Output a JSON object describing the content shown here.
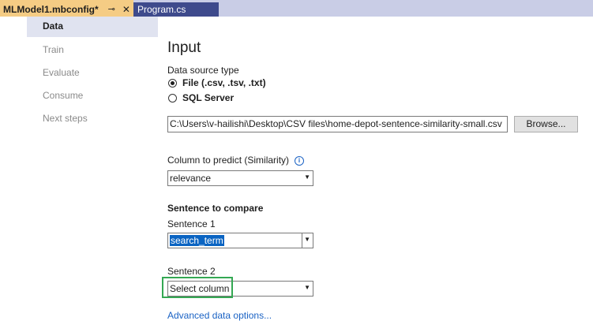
{
  "tabs": [
    {
      "label": "MLModel1.mbconfig*",
      "pin_icon": "pin-icon",
      "close_icon": "close-icon"
    },
    {
      "label": "Program.cs"
    }
  ],
  "steps": [
    "Data",
    "Train",
    "Evaluate",
    "Consume",
    "Next steps"
  ],
  "active_step": "Data",
  "input": {
    "heading": "Input",
    "data_source_label": "Data source type",
    "options": [
      {
        "label": "File (.csv, .tsv, .txt)",
        "checked": true
      },
      {
        "label": "SQL Server",
        "checked": false
      }
    ],
    "file_path": "C:\\Users\\v-hailishi\\Desktop\\CSV files\\home-depot-sentence-similarity-small.csv",
    "browse_label": "Browse..."
  },
  "predict": {
    "label": "Column to predict (Similarity)",
    "value": "relevance"
  },
  "compare": {
    "heading": "Sentence to compare",
    "sentence1_label": "Sentence 1",
    "sentence1_value": "search_term",
    "sentence2_label": "Sentence 2",
    "sentence2_value": "Select column"
  },
  "advanced_link": "Advanced data options...",
  "colors": {
    "active_tab": "#f5cc84",
    "tab_bar": "#c9cde6",
    "inactive_tab": "#3e4a8c",
    "link": "#1a62c4",
    "highlight_box": "#34a853"
  }
}
